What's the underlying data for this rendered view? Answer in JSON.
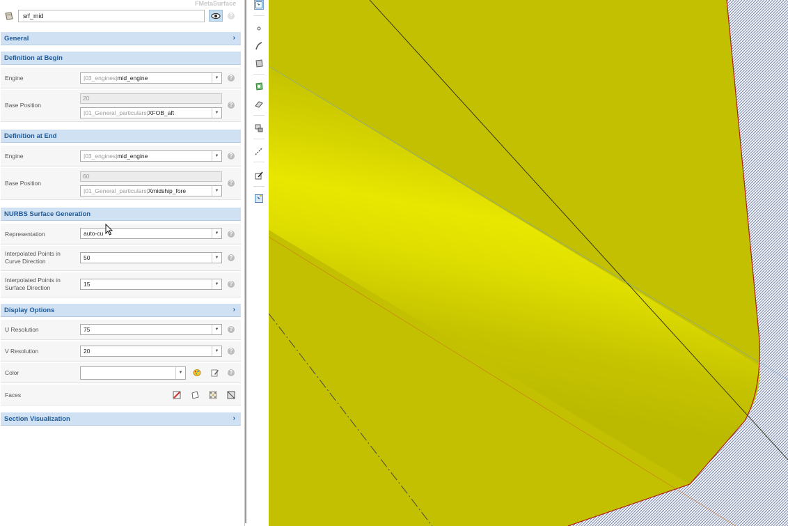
{
  "panel_title": "FMetaSurface",
  "object_name": "srf_mid",
  "sections": {
    "general": "General",
    "def_begin": "Definition at Begin",
    "def_end": "Definition at End",
    "nurbs": "NURBS Surface Generation",
    "display": "Display Options",
    "section_vis": "Section Visualization"
  },
  "def_begin": {
    "engine_label": "Engine",
    "engine_prefix": "|03_engines|",
    "engine_value": "mid_engine",
    "base_label": "Base Position",
    "base_number": "20",
    "base_prefix": "|01_General_particulars|",
    "base_value": "XFOB_aft"
  },
  "def_end": {
    "engine_label": "Engine",
    "engine_prefix": "|03_engines|",
    "engine_value": "mid_engine",
    "base_label": "Base Position",
    "base_number": "60",
    "base_prefix": "|01_General_particulars|",
    "base_value": "Xmidship_fore"
  },
  "nurbs": {
    "rep_label": "Representation",
    "rep_value": "auto-cu",
    "curve_label_1": "Interpolated Points in",
    "curve_label_2": "Curve Direction",
    "curve_value": "50",
    "surf_label_1": "Interpolated Points in",
    "surf_label_2": "Surface Direction",
    "surf_value": "15"
  },
  "display": {
    "u_label": "U Resolution",
    "u_value": "75",
    "v_label": "V Resolution",
    "v_value": "20",
    "color_label": "Color",
    "color_value": "",
    "faces_label": "Faces"
  },
  "help_glyph": "?",
  "dropdown_glyph": "▼",
  "chevron_glyph": "›",
  "colors": {
    "accent": "#1f5a99",
    "section_bg": "#cfe1f2",
    "surface_yellow": "#c2c000",
    "surface_highlight": "#e6e600"
  }
}
